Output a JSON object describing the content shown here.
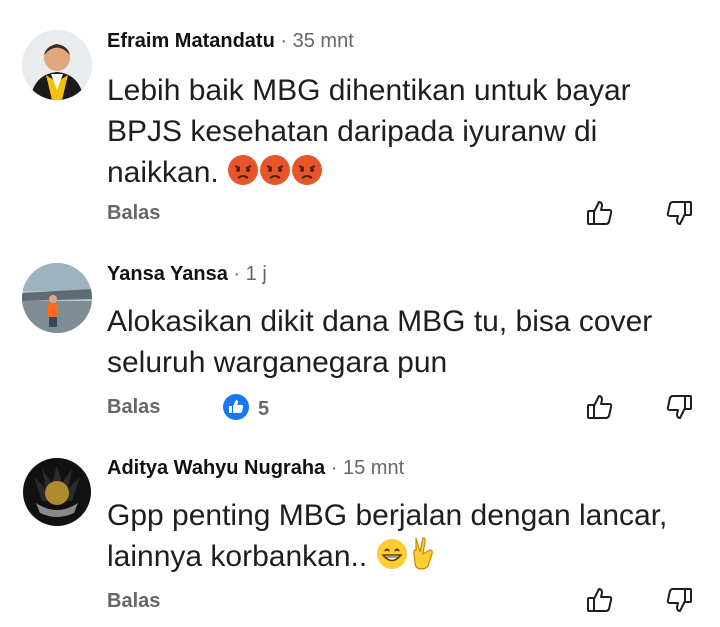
{
  "comments": [
    {
      "author": "Efraim Matandatu",
      "separator": "·",
      "time": "35 mnt",
      "lines": [
        "Lebih baik MBG dihentikan untuk bayar",
        "BPJS kesehatan daripada iyuranw di",
        "naikkan."
      ],
      "emojis": [
        "angry-face",
        "angry-face",
        "angry-face"
      ],
      "reply_label": "Balas"
    },
    {
      "author": "Yansa Yansa",
      "separator": "·",
      "time": "1 j",
      "lines": [
        "Alokasikan dikit dana MBG tu, bisa cover",
        "seluruh warganegara pun"
      ],
      "reply_label": "Balas",
      "reaction": {
        "icon": "like-reaction-icon",
        "count": "5",
        "color": "#1877f2"
      }
    },
    {
      "author": "Aditya Wahyu Nugraha",
      "separator": "·",
      "time": "15 mnt",
      "lines": [
        "Gpp penting MBG berjalan dengan lancar,",
        "lainnya korbankan.."
      ],
      "emojis": [
        "grinning-face",
        "victory-hand"
      ],
      "reply_label": "Balas"
    }
  ],
  "icons": {
    "like": "thumbs-up-outline-icon",
    "dislike": "thumbs-down-outline-icon"
  },
  "colors": {
    "text": "#1c1e21",
    "muted": "#65676b",
    "accent": "#1877f2",
    "angry": "#e8552b"
  }
}
